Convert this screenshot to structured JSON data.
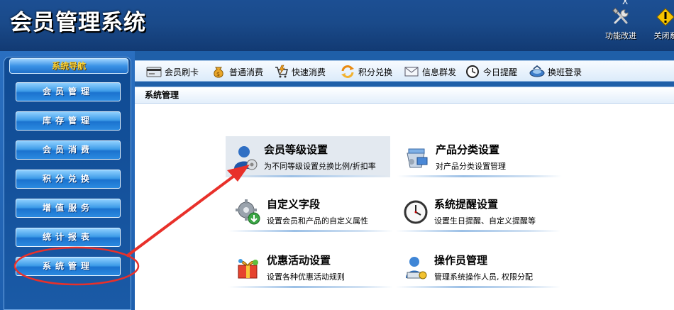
{
  "header": {
    "title": "会员管理系统",
    "tools": [
      {
        "label": "功能改进",
        "icon": "tools-icon"
      },
      {
        "label": "关闭系",
        "icon": "warning-icon"
      }
    ],
    "close_glyph": "X"
  },
  "sidebar": {
    "title": "系统导航",
    "items": [
      {
        "label": "会员管理"
      },
      {
        "label": "库存管理"
      },
      {
        "label": "会员消费"
      },
      {
        "label": "积分兑换"
      },
      {
        "label": "增值服务"
      },
      {
        "label": "统计报表"
      },
      {
        "label": "系统管理",
        "circled": true
      }
    ]
  },
  "toolbar": {
    "items": [
      {
        "label": "会员刷卡",
        "icon": "card-reader-icon"
      },
      {
        "label": "普通消费",
        "icon": "money-bag-icon"
      },
      {
        "label": "快速消费",
        "icon": "fast-shopping-icon"
      },
      {
        "label": "积分兑换",
        "icon": "exchange-icon"
      },
      {
        "label": "信息群发",
        "icon": "mail-icon"
      },
      {
        "label": "今日提醒",
        "icon": "clock-icon"
      },
      {
        "label": "换班登录",
        "icon": "shift-login-icon"
      }
    ]
  },
  "panel": {
    "title": "系统管理",
    "cards": [
      {
        "title": "会员等级设置",
        "desc": "为不同等级设置兑换比例/折扣率",
        "icon": "member-level-icon",
        "highlighted": true
      },
      {
        "title": "产品分类设置",
        "desc": "对产品分类设置管理",
        "icon": "product-category-icon"
      },
      {
        "title": "自定义字段",
        "desc": "设置会员和产品的自定义属性",
        "icon": "custom-field-gear-icon"
      },
      {
        "title": "系统提醒设置",
        "desc": "设置生日提醒、自定义提醒等",
        "icon": "alarm-clock-icon"
      },
      {
        "title": "优惠活动设置",
        "desc": "设置各种优惠活动规则",
        "icon": "gift-icon"
      },
      {
        "title": "操作员管理",
        "desc": "管理系统操作人员, 权限分配",
        "icon": "operator-icon"
      }
    ]
  },
  "colors": {
    "header_bg": "#1a4a8a",
    "nav_title_text": "#f7d23b",
    "annotation_red": "#e8302a"
  }
}
